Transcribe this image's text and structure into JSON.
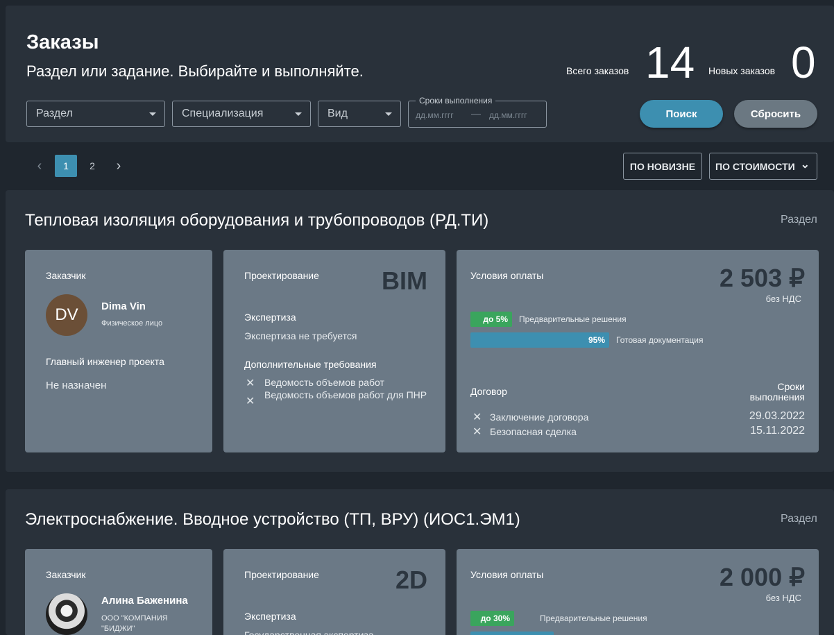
{
  "header": {
    "title": "Заказы",
    "subtitle": "Раздел или задание. Выбирайте и выполняйте.",
    "total_label": "Всего заказов",
    "total_value": "14",
    "new_label": "Новых заказов",
    "new_value": "0",
    "filters": {
      "section": "Раздел",
      "specialization": "Специализация",
      "type": "Вид",
      "dates_legend": "Сроки выполнения",
      "date_from_placeholder": "дд.мм.гггг",
      "date_to_placeholder": "дд.мм.гггг",
      "dash": "—"
    },
    "search_label": "Поиск",
    "reset_label": "Сбросить"
  },
  "pagination": {
    "prev": "‹",
    "pages": [
      "1",
      "2"
    ],
    "next": "›",
    "active": 1
  },
  "sort": {
    "newest": "ПО НОВИЗНЕ",
    "price": "ПО СТОИМОСТИ",
    "price_chevron": "⌄"
  },
  "orders": [
    {
      "title": "Тепловая изоляция оборудования и трубопроводов (РД.ТИ)",
      "tag": "Раздел",
      "customer_label": "Заказчик",
      "avatar_initials": "DV",
      "customer_name": "Dima Vin",
      "customer_type": "Физическое лицо",
      "engineer_label": "Главный инженер проекта",
      "engineer_value": "Не назначен",
      "design_label": "Проектирование",
      "design_code": "BIM",
      "expertise_label": "Экспертиза",
      "expertise_value": "Экспертиза не требуется",
      "extra_label": "Дополнительные требования",
      "extra_items": [
        "Ведомость объемов работ",
        "Ведомость объемов работ для ПНР"
      ],
      "payment_label": "Условия оплаты",
      "price": "2 503 ₽",
      "vat": "без НДС",
      "stages": [
        {
          "badge": "до 5%",
          "label": "Предварительные решения",
          "share": 0.05,
          "color": "#3aa55d"
        },
        {
          "badge": "95%",
          "label": "Готовая документация",
          "share": 0.95,
          "color": "#3d8fb0"
        }
      ],
      "contract_label": "Договор",
      "deadline_label": "Сроки выполнения",
      "contract_items": [
        "Заключение договора",
        "Безопасная сделка"
      ],
      "contract_dates": [
        "29.03.2022",
        "15.11.2022"
      ]
    },
    {
      "title": "Электроснабжение. Вводное устройство (ТП, ВРУ) (ИОС1.ЭМ1)",
      "tag": "Раздел",
      "customer_label": "Заказчик",
      "avatar_icon": "user-photo-icon",
      "customer_name": "Алина Баженина",
      "customer_type": "ООО \"КОМПАНИЯ \"БИДЖИ\"",
      "design_label": "Проектирование",
      "design_code": "2D",
      "expertise_label": "Экспертиза",
      "expertise_value": "Государственная экспертиза",
      "payment_label": "Условия оплаты",
      "price": "2 000 ₽",
      "vat": "без НДС",
      "stages": [
        {
          "badge": "до 30%",
          "label": "Предварительные решения",
          "share": 0.3,
          "color": "#3aa55d"
        }
      ]
    }
  ]
}
